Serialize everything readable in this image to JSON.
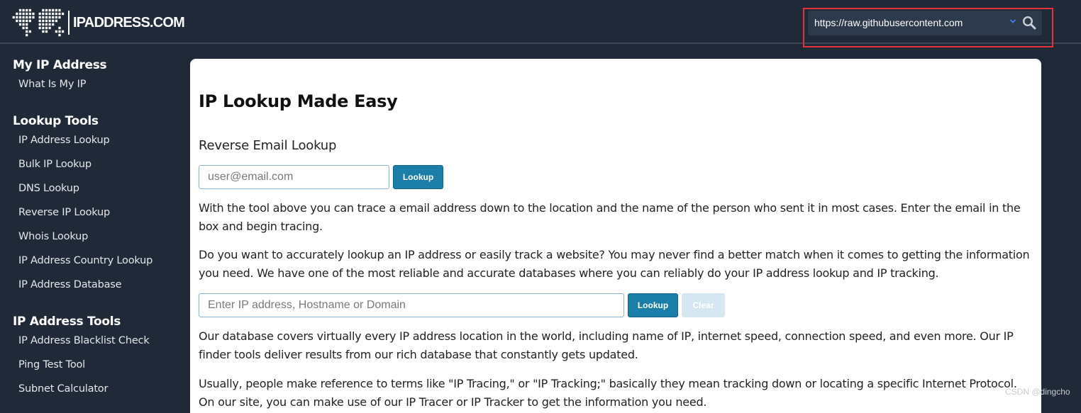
{
  "header": {
    "logo_text": "IPADDRESS.COM",
    "search_value": "https://raw.githubusercontent.com",
    "highlight_color": "#e2323a"
  },
  "sidebar": {
    "sections": [
      {
        "heading": "My IP Address",
        "items": [
          "What Is My IP"
        ]
      },
      {
        "heading": "Lookup Tools",
        "items": [
          "IP Address Lookup",
          "Bulk IP Lookup",
          "DNS Lookup",
          "Reverse IP Lookup",
          "Whois Lookup",
          "IP Address Country Lookup",
          "IP Address Database"
        ]
      },
      {
        "heading": "IP Address Tools",
        "items": [
          "IP Address Blacklist Check",
          "Ping Test Tool",
          "Subnet Calculator"
        ]
      }
    ]
  },
  "main": {
    "title": "IP Lookup Made Easy",
    "email_section_title": "Reverse Email Lookup",
    "email_placeholder": "user@email.com",
    "email_button": "Lookup",
    "para1": "With the tool above you can trace a email address down to the location and the name of the person who sent it in most cases. Enter the email in the box and begin tracing.",
    "para2": "Do you want to accurately lookup an IP address or easily track a website? You may never find a better match when it comes to getting the information you need. We have one of the most reliable and accurate databases where you can reliably do your IP address lookup and IP tracking.",
    "ip_placeholder": "Enter IP address, Hostname or Domain",
    "ip_button": "Lookup",
    "clear_button": "Clear",
    "para3": "Our database covers virtually every IP address location in the world, including name of IP, internet speed, connection speed, and even more. Our IP finder tools deliver results from our rich database that constantly gets updated.",
    "para4": "Usually, people make reference to terms like \"IP Tracing,\" or \"IP Tracking;\" basically they mean tracking down or locating a specific Internet Protocol. On our site, you can make use of our IP Tracer or IP Tracker to get the information you need."
  },
  "watermark": "CSDN @dingcho",
  "colors": {
    "background": "#1f2937",
    "accent": "#1a7ea9"
  },
  "icons": [
    "world-map-icon",
    "chevron-down-icon",
    "search-icon"
  ]
}
